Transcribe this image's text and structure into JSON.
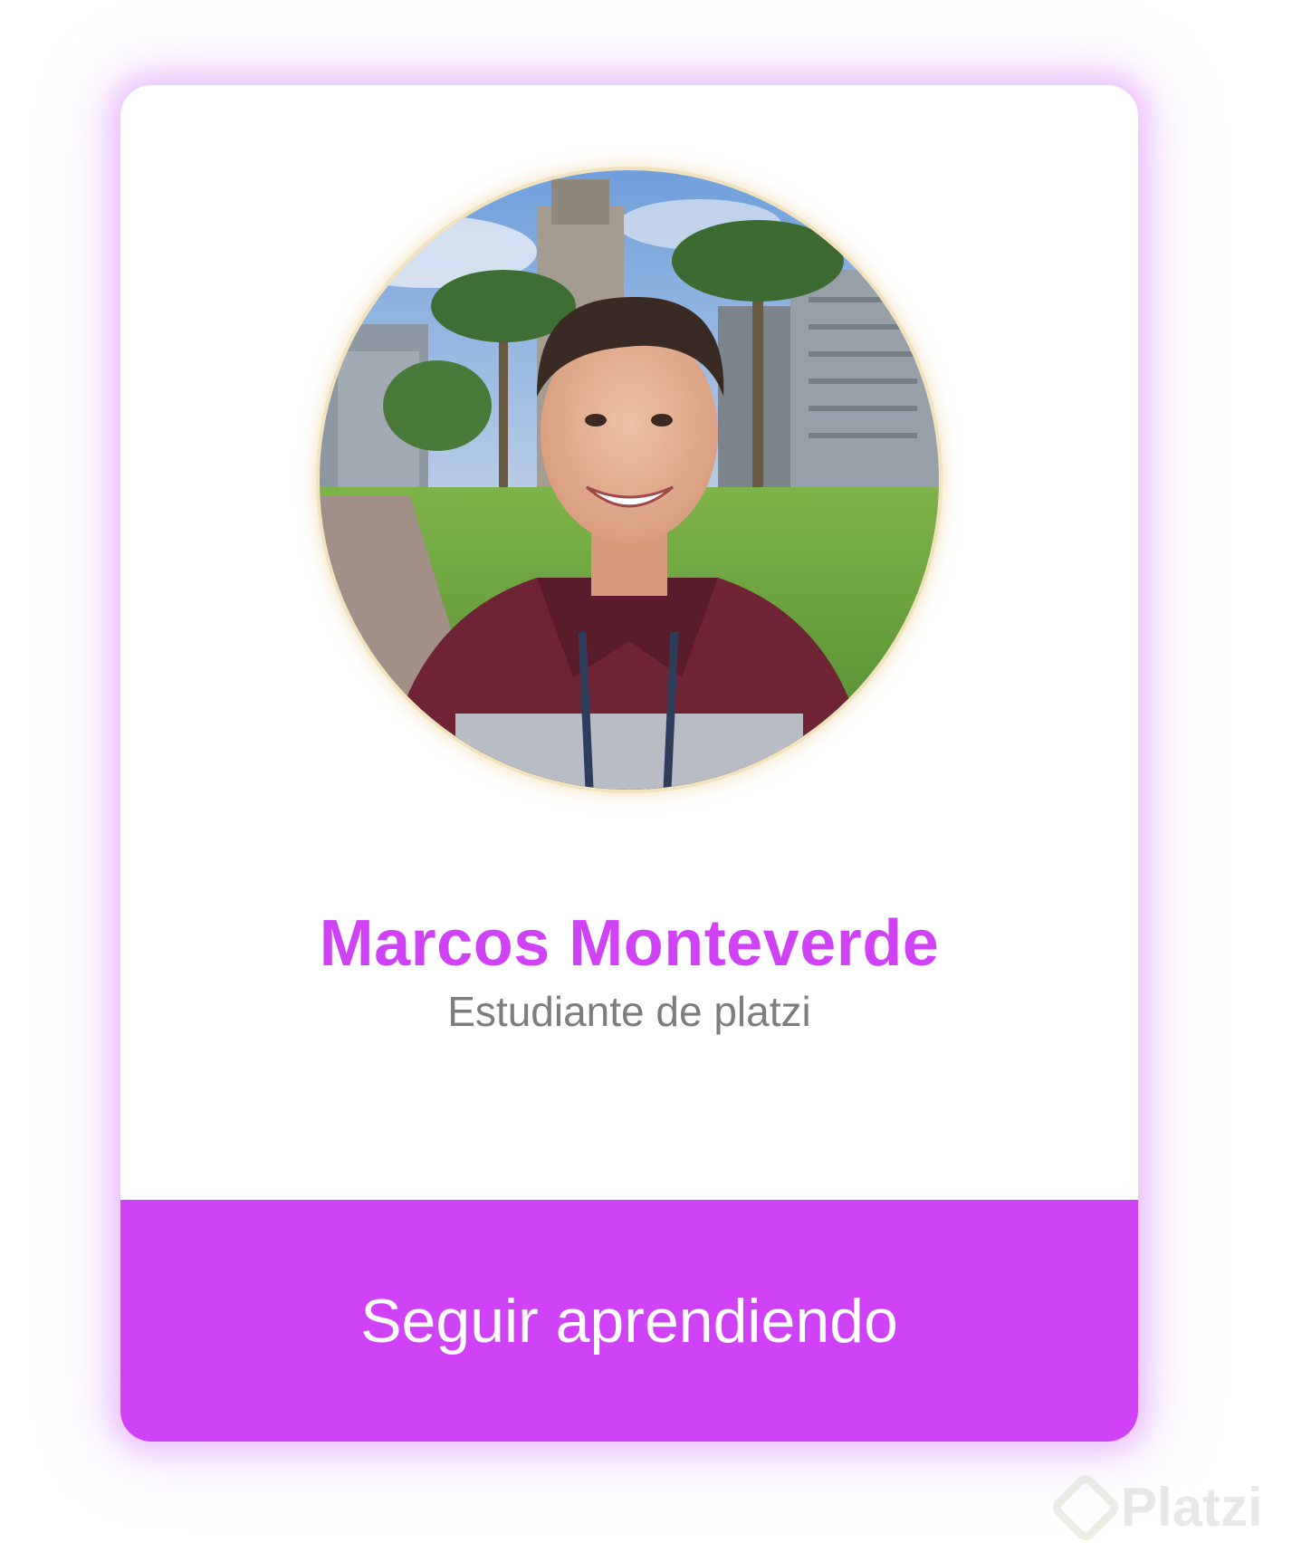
{
  "profile": {
    "photo_alt": "profile-photo",
    "name": "Marcos Monteverde",
    "role": "Estudiante de platzi"
  },
  "actions": {
    "continue_label": "Seguir aprendiendo"
  },
  "watermark": {
    "brand": "Platzi"
  },
  "colors": {
    "accent": "#d042f6",
    "role_text": "#7d7d7d",
    "glow": "#e0a8fa"
  }
}
